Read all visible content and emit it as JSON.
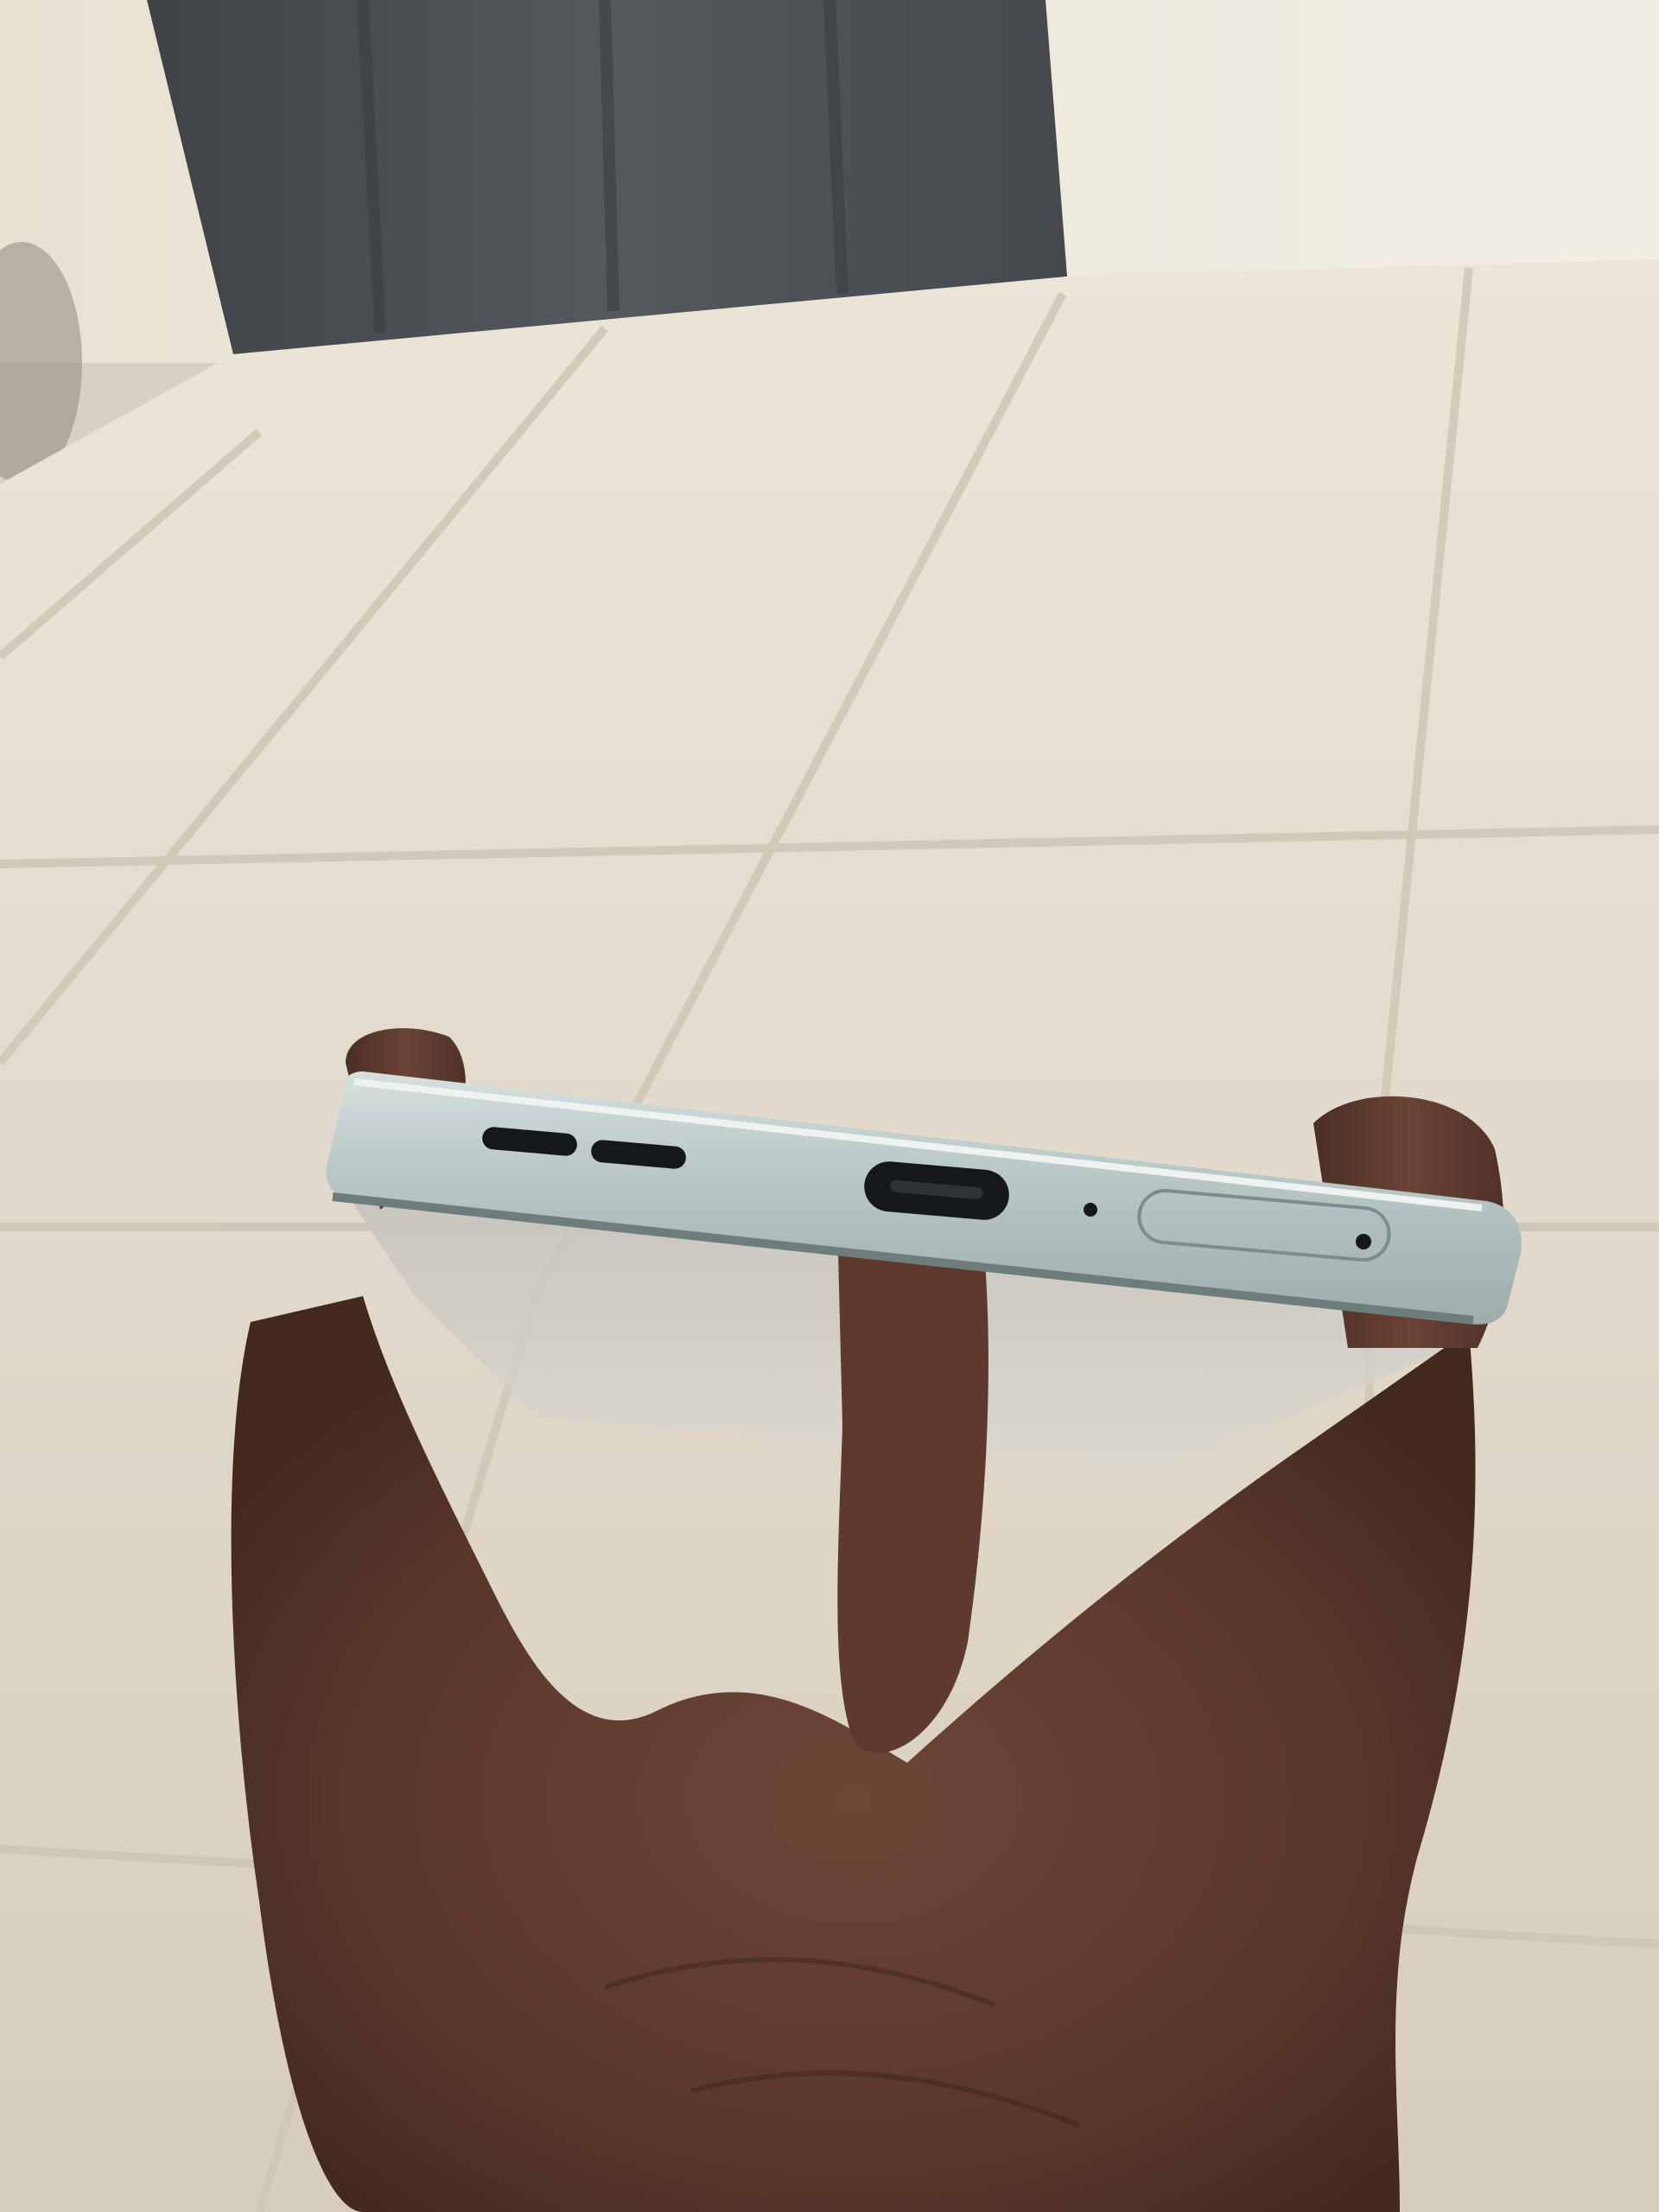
{
  "image": {
    "description_tags": [
      "photo",
      "phone-bottom-edge",
      "hand",
      "tiled-floor"
    ],
    "colors": {
      "wall": "#ece7da",
      "door": "#4e5256",
      "floor": "#ddd4c5",
      "grout": "#c9bfb0",
      "phone_frame": "#b9c7c6",
      "phone_frame_shadow": "#8e9c9c",
      "skin": "#5a3a2e",
      "skin_highlight": "#7a5040",
      "port": "#15181a"
    },
    "objects": {
      "speaker_grille_count": 2,
      "port_type": "usb-c",
      "has_microphone_hole": true,
      "has_sim_tray": true
    }
  }
}
